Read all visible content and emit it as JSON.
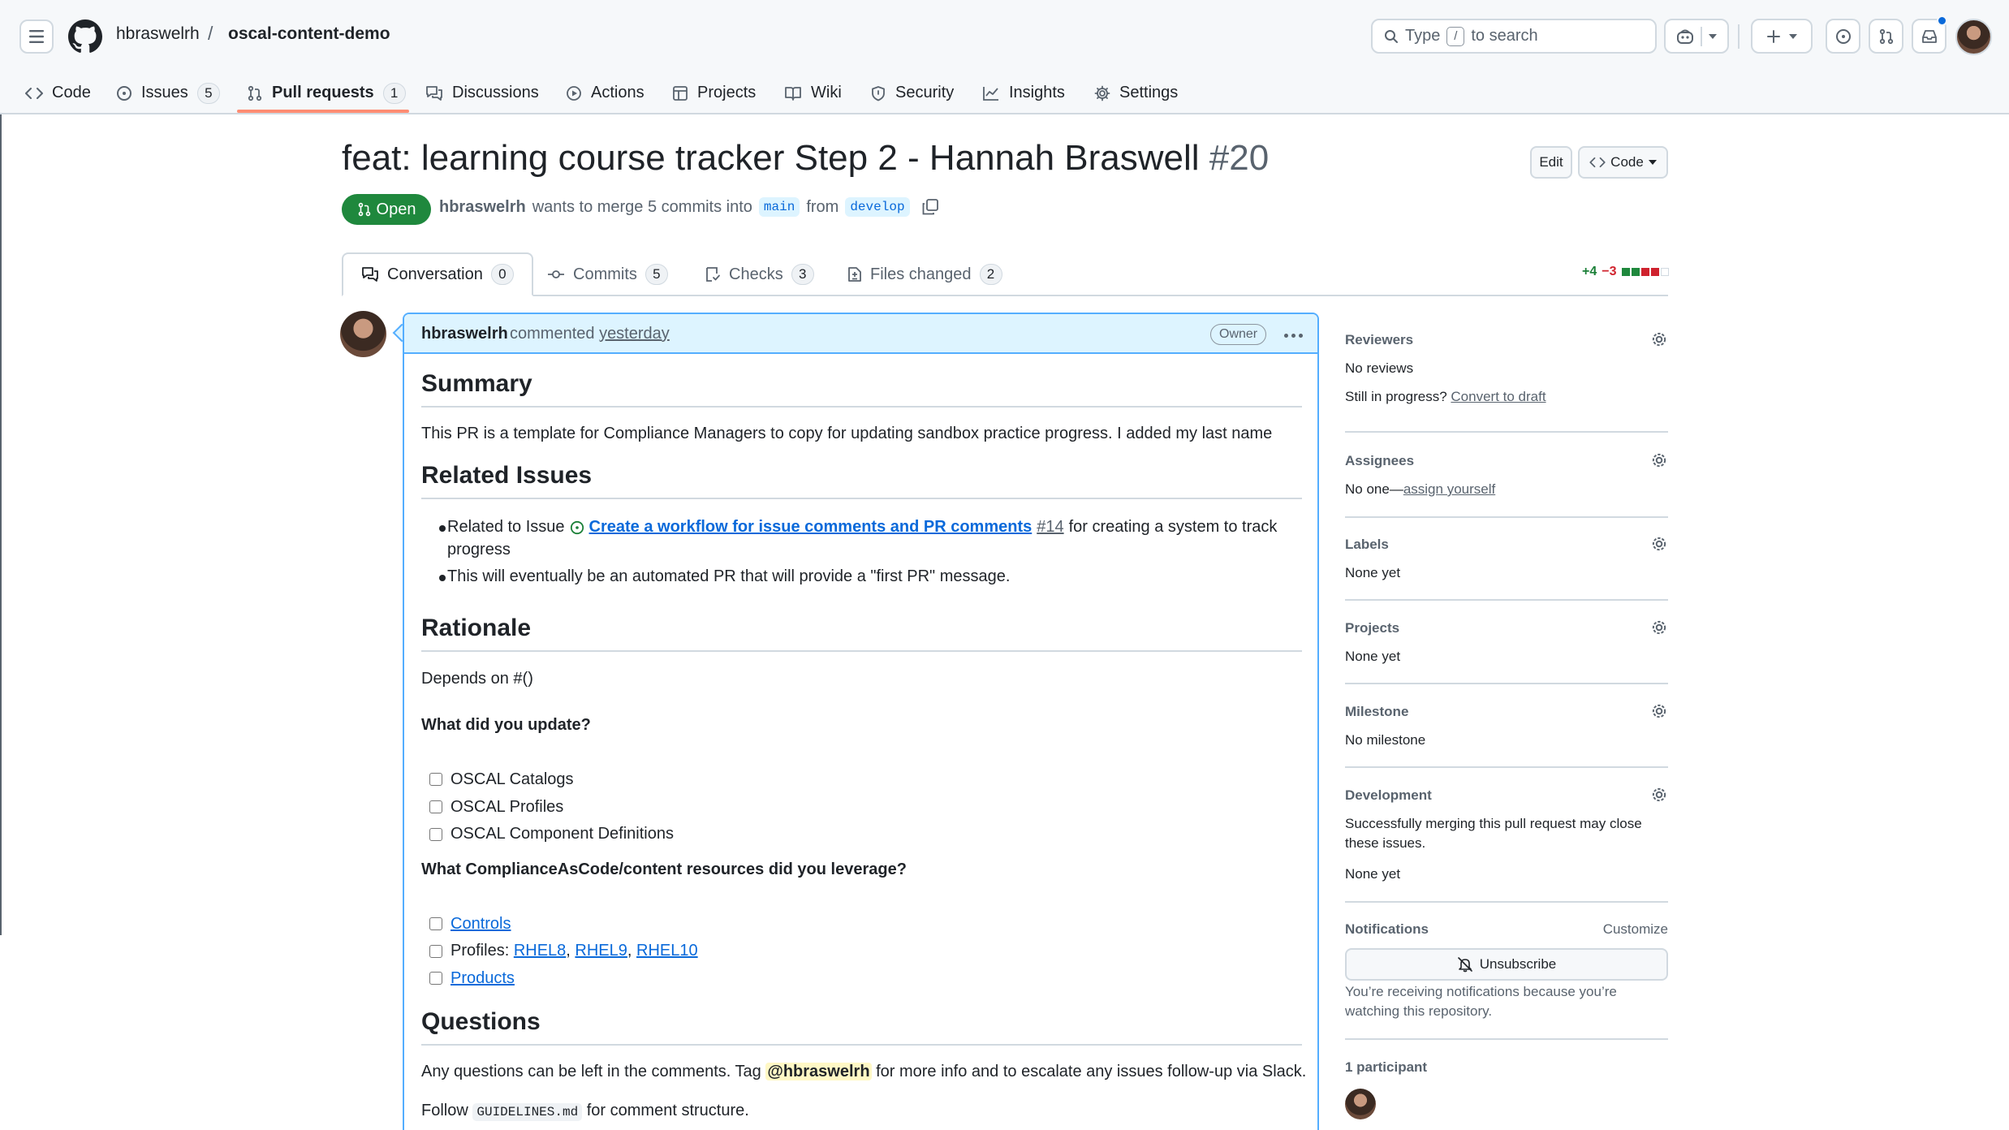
{
  "header": {
    "owner": "hbraswelrh",
    "separator": "/",
    "repo": "oscal-content-demo",
    "search_placeholder_prefix": "Type",
    "search_key": "/",
    "search_placeholder_suffix": "to search"
  },
  "repo_nav": {
    "items": [
      {
        "label": "Code",
        "icon": "code-icon"
      },
      {
        "label": "Issues",
        "icon": "issue-opened-icon",
        "count": "5"
      },
      {
        "label": "Pull requests",
        "icon": "git-pull-request-icon",
        "count": "1",
        "selected": true
      },
      {
        "label": "Discussions",
        "icon": "comment-discussion-icon"
      },
      {
        "label": "Actions",
        "icon": "play-icon"
      },
      {
        "label": "Projects",
        "icon": "table-icon"
      },
      {
        "label": "Wiki",
        "icon": "book-icon"
      },
      {
        "label": "Security",
        "icon": "shield-icon"
      },
      {
        "label": "Insights",
        "icon": "graph-icon"
      },
      {
        "label": "Settings",
        "icon": "gear-icon"
      }
    ],
    "accent_color": "#fd8c73"
  },
  "pr": {
    "title": "feat: learning course tracker Step 2 - Hannah Braswell",
    "number": "#20",
    "edit_label": "Edit",
    "code_label": "Code",
    "state": "Open",
    "state_color": "#1f883d",
    "author": "hbraswelrh",
    "merge_text": "wants to merge 5 commits into",
    "base_branch": "main",
    "from_text": "from",
    "head_branch": "develop"
  },
  "tabs": [
    {
      "label": "Conversation",
      "count": "0",
      "icon": "comment-discussion-icon"
    },
    {
      "label": "Commits",
      "count": "5",
      "icon": "git-commit-icon"
    },
    {
      "label": "Checks",
      "count": "3",
      "icon": "checklist-icon"
    },
    {
      "label": "Files changed",
      "count": "2",
      "icon": "file-diff-icon"
    }
  ],
  "diffstat": {
    "additions": "+4",
    "deletions": "−3"
  },
  "comment": {
    "author": "hbraswelrh",
    "action": "commented",
    "time": "yesterday",
    "role": "Owner",
    "summary_heading": "Summary",
    "summary_text": "This PR is a template for Compliance Managers to copy for updating sandbox practice progress. I added my last name",
    "related_heading": "Related Issues",
    "related_item1_prefix": "Related to Issue",
    "related_issue_title": "Create a workflow for issue comments and PR comments",
    "related_issue_number": "#14",
    "related_item1_suffix": "for creating a system to track",
    "related_item1_wrap": "progress",
    "related_item2": "This will eventually be an automated PR that will provide a \"first PR\" message.",
    "rationale_heading": "Rationale",
    "depends_text": "Depends on #()",
    "update_question": "What did you update?",
    "update_options": [
      "OSCAL Catalogs",
      "OSCAL Profiles",
      "OSCAL Component Definitions"
    ],
    "resources_question": "What ComplianceAsCode/content resources did you leverage?",
    "resources": {
      "controls": "Controls",
      "profiles_prefix": "Profiles:",
      "profile_links": [
        "RHEL8",
        "RHEL9",
        "RHEL10"
      ],
      "products": "Products"
    },
    "questions_heading": "Questions",
    "questions_prefix": "Any questions can be left in the comments. Tag",
    "questions_mention": "@hbraswelrh",
    "questions_suffix": "for more info and to escalate any issues follow-up via Slack.",
    "follow_prefix": "Follow",
    "follow_code": "GUIDELINES.md",
    "follow_suffix": "for comment structure."
  },
  "sidebar": {
    "reviewers": {
      "heading": "Reviewers",
      "value": "No reviews",
      "draft_prefix": "Still in progress?",
      "draft_link": "Convert to draft"
    },
    "assignees": {
      "heading": "Assignees",
      "prefix": "No one—",
      "link": "assign yourself"
    },
    "labels": {
      "heading": "Labels",
      "value": "None yet"
    },
    "projects": {
      "heading": "Projects",
      "value": "None yet"
    },
    "milestone": {
      "heading": "Milestone",
      "value": "No milestone"
    },
    "development": {
      "heading": "Development",
      "line1": "Successfully merging this pull request may close",
      "line2": "these issues.",
      "value": "None yet"
    },
    "notifications": {
      "heading": "Notifications",
      "customize": "Customize",
      "button": "Unsubscribe",
      "line1": "You’re receiving notifications because you’re",
      "line2": "watching this repository."
    },
    "participants": {
      "heading": "1 participant"
    }
  }
}
